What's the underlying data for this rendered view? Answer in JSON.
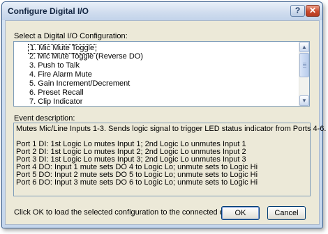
{
  "window": {
    "title": "Configure Digital I/O"
  },
  "config_section": {
    "label": "Select a Digital I/O Configuration:",
    "items": [
      "1. Mic Mute Toggle",
      "2. Mic Mute Toggle (Reverse DO)",
      "3. Push to Talk",
      "4. Fire Alarm Mute",
      "5. Gain Increment/Decrement",
      "6. Preset Recall",
      "7. Clip Indicator"
    ],
    "selected_index": 0
  },
  "description": {
    "label": "Event description:",
    "lines": [
      "Mutes Mic/Line Inputs 1-3.  Sends logic signal to trigger LED status indicator from Ports 4-6.",
      "",
      "Port 1 DI: 1st Logic Lo mutes Input 1; 2nd Logic Lo unmutes Input 1",
      "Port 2 DI: 1st Logic Lo mutes Input 2; 2nd Logic Lo unmutes Input 2",
      "Port 3 DI: 1st Logic Lo mutes Input 3; 2nd Logic Lo unmutes Input 3",
      "Port 4 DO: Input 1 mute sets DO 4 to Logic Lo; unmute sets to Logic Hi",
      "Port 5 DO: Input 2 mute sets DO 5 to Logic Lo; unmute sets to Logic Hi",
      "Port 6 DO: Input 3 mute sets DO 6 to Logic Lo; unmute sets to Logic Hi"
    ]
  },
  "footer": {
    "hint": "Click OK to load the selected configuration to the connected device.",
    "ok_label": "OK",
    "cancel_label": "Cancel"
  },
  "titlebar_buttons": {
    "help": "?",
    "close": "✕"
  },
  "colors": {
    "title_text": "#10233f",
    "dialog_face": "#ece9d8",
    "list_border": "#7f9db9",
    "close_button": "#c94a2d"
  }
}
